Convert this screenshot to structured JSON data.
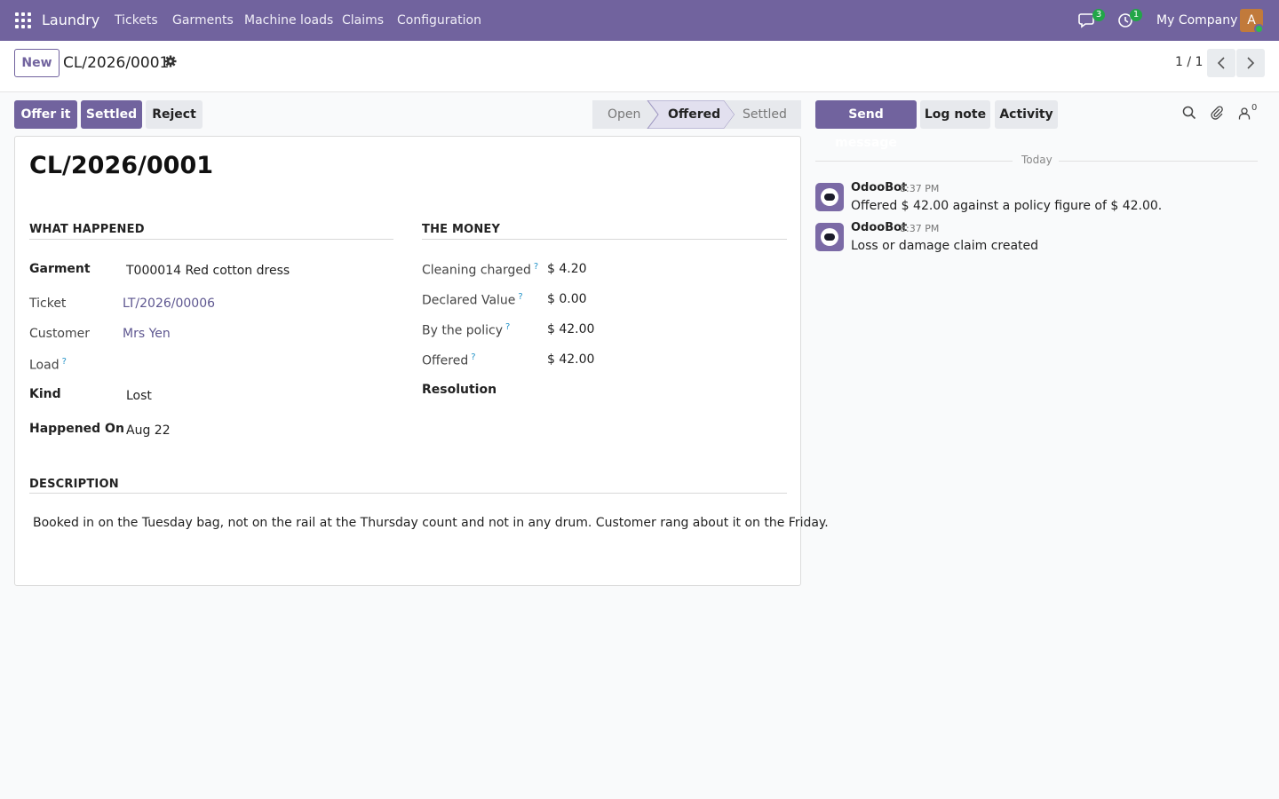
{
  "navbar": {
    "app_name": "Laundry",
    "menus": [
      "Tickets",
      "Garments",
      "Machine loads",
      "Claims",
      "Configuration"
    ],
    "messages_badge": "3",
    "activities_badge": "1",
    "company": "My Company",
    "user_initial": "A"
  },
  "control": {
    "new_label": "New",
    "breadcrumb": "CL/2026/0001",
    "pager": "1 / 1"
  },
  "actions": {
    "offer_label": "Offer it",
    "settled_label": "Settled",
    "reject_label": "Reject"
  },
  "stages": {
    "items": [
      "Open",
      "Offered",
      "Settled"
    ],
    "current": "Offered"
  },
  "record": {
    "title": "CL/2026/0001",
    "what_happened": {
      "heading": "What Happened",
      "garment_label": "Garment",
      "garment_value": "T000014 Red cotton dress",
      "ticket_label": "Ticket",
      "ticket_value": "LT/2026/00006",
      "customer_label": "Customer",
      "customer_value": "Mrs Yen",
      "load_label": "Load",
      "kind_label": "Kind",
      "kind_value": "Lost",
      "happened_label": "Happened On",
      "happened_value": "Aug 22"
    },
    "money": {
      "heading": "The Money",
      "cleaning_label": "Cleaning charged",
      "cleaning_value": "$ 4.20",
      "declared_label": "Declared Value",
      "declared_value": "$ 0.00",
      "policy_label": "By the policy",
      "policy_value": "$ 42.00",
      "offered_label": "Offered",
      "offered_value": "$ 42.00",
      "resolution_label": "Resolution"
    },
    "description": {
      "heading": "Description",
      "text": "Booked in on the Tuesday bag, not on the rail at the Thursday count and not in any drum. Customer rang about it on the Friday."
    }
  },
  "chatter": {
    "send_message_label": "Send message",
    "log_note_label": "Log note",
    "activity_label": "Activity",
    "followers_count": "0",
    "date_separator": "Today",
    "messages": [
      {
        "author": "OdooBot",
        "time": "8:37 PM",
        "body": "Offered $ 42.00 against a policy figure of $ 42.00."
      },
      {
        "author": "OdooBot",
        "time": "8:37 PM",
        "body": "Loss or damage claim created"
      }
    ]
  },
  "colors": {
    "brand": "#71639e",
    "badge_green": "#22a648",
    "link": "#5e5790",
    "help": "#2493c8"
  }
}
